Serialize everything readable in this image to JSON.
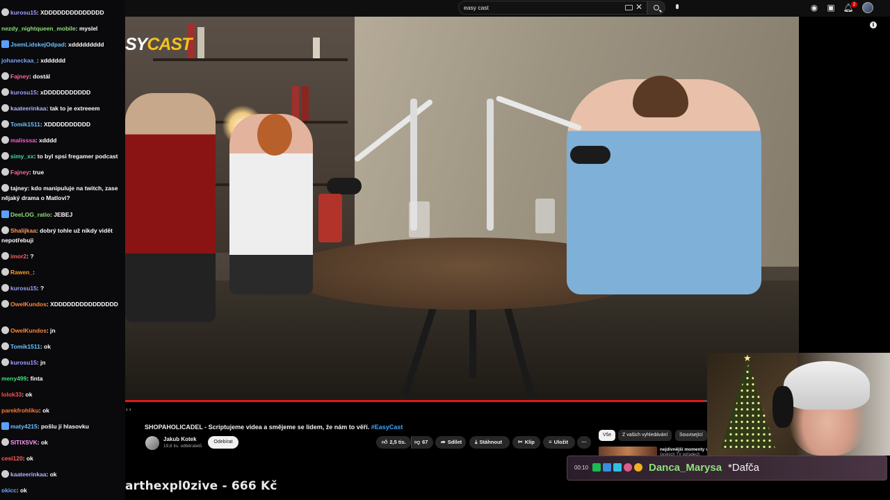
{
  "chat": {
    "messages": [
      {
        "user": "kurosu15",
        "text": "XDDDDDDDDDDDDDD",
        "user_color": "#a0a0ff",
        "badge": "hx"
      },
      {
        "user": "nezdy_nightqueen_mobile",
        "text": "myslel",
        "user_color": "#8ee07a",
        "badge": ""
      },
      {
        "user": "JsemLidskejOdpad",
        "text": "xddddddddd",
        "user_color": "#6ec1ff",
        "badge": "sq"
      },
      {
        "user": "johaneckaa_",
        "text": "xdddddd",
        "user_color": "#7aa7ff",
        "badge": ""
      },
      {
        "user": "Fajney",
        "text": "dostál",
        "user_color": "#ff6b9a",
        "badge": "hx"
      },
      {
        "user": "kurosu15",
        "text": "xDDDDDDDDDDD",
        "user_color": "#a0a0ff",
        "badge": "hx"
      },
      {
        "user": "kaateerinkaa",
        "text": "tak to je extreeem",
        "user_color": "#b5b5ff",
        "badge": "hx"
      },
      {
        "user": "Tomik1511",
        "text": "XDDDDDDDDDD",
        "user_color": "#6ec1ff",
        "badge": "hx"
      },
      {
        "user": "malisssa",
        "text": "xdddd",
        "user_color": "#ff5fd0",
        "badge": "hx"
      },
      {
        "user": "simy_xx",
        "text": "to byl spsi fregamer podcast",
        "user_color": "#3ee0a0",
        "badge": "hx"
      },
      {
        "user": "Fajney",
        "text": "true",
        "user_color": "#ff6b9a",
        "badge": "hx"
      },
      {
        "user": "tajney",
        "text": "kdo manipuluje na twitch, zase nějaký drama o Matlovi?",
        "user_color": "#ffffff",
        "badge": "hx"
      },
      {
        "user": "DeeLOG_ratio",
        "text": "JEBEJ",
        "user_color": "#8ee07a",
        "badge": "sq"
      },
      {
        "user": "Shalijkaa",
        "text": "dobrý tohle už nikdy vidět nepotřebuji",
        "user_color": "#ff9a5a",
        "badge": "hx"
      },
      {
        "user": "imor2",
        "text": "?",
        "user_color": "#ff5f5f",
        "badge": "hx"
      },
      {
        "user": "Rawen_",
        "text": "",
        "user_color": "#ff9a2a",
        "badge": "hx"
      },
      {
        "user": "kurosu15",
        "text": "?",
        "user_color": "#a0a0ff",
        "badge": "hx"
      },
      {
        "user": "OwelKundos",
        "text": "XDDDDDDDDDDDDDDD",
        "user_color": "#ff8a3a",
        "badge": "hx"
      },
      {
        "user": "OwelKundos",
        "text": "jn",
        "user_color": "#ff8a3a",
        "badge": "hx"
      },
      {
        "user": "Tomik1511",
        "text": "ok",
        "user_color": "#6ec1ff",
        "badge": "hx"
      },
      {
        "user": "kurosu15",
        "text": "jn",
        "user_color": "#a0a0ff",
        "badge": "hx"
      },
      {
        "user": "meny499",
        "text": "finta",
        "user_color": "#3ee07a",
        "badge": ""
      },
      {
        "user": "lolok33",
        "text": "ok",
        "user_color": "#ff4f4f",
        "badge": ""
      },
      {
        "user": "parekfrohliku",
        "text": "ok",
        "user_color": "#ff7a3a",
        "badge": ""
      },
      {
        "user": "maty4215",
        "text": "pošlu jí hlasovku",
        "user_color": "#6ec1ff",
        "badge": "sq"
      },
      {
        "user": "SITIXSVK",
        "text": "ok",
        "user_color": "#ff9aff",
        "badge": "hx"
      },
      {
        "user": "cesi120",
        "text": "ok",
        "user_color": "#ff5f5f",
        "badge": ""
      },
      {
        "user": "kaateerinkaa",
        "text": "ok",
        "user_color": "#b5b5ff",
        "badge": "hx"
      },
      {
        "user": "okicc",
        "text": "ok",
        "user_color": "#7aa7ff",
        "badge": ""
      }
    ]
  },
  "youtube": {
    "search_query": "easy cast",
    "notification_count": "2",
    "video_logo_left": "SY",
    "video_logo_right": "CAST",
    "video_title": "SHOPAHOLICADEL - Scriptujeme videa a smějeme se lidem, že nám to věří.",
    "video_hashtag": "#EasyCast",
    "channel_name": "Jakub Kotek",
    "channel_subs": "19,8 tis. odběratelů",
    "subscribe_label": "Odebírat",
    "likes": "2,5 tis.",
    "dislikes": "67",
    "share_label": "Sdílet",
    "download_label": "Stáhnout",
    "clip_label": "Klip",
    "save_label": "Uložit",
    "more_label": "···",
    "progress": 0.86,
    "chips": [
      "Vše",
      "Z vašich vyhledávání",
      "Související"
    ],
    "rec_title": "nejdivnější momenty v",
    "rec_sub": "českých TV pořadech"
  },
  "overlay": {
    "donation_text": "arthexpl0zive - 666 Kč",
    "alert_time": "00:10",
    "alert_user": "Danca_Marysa",
    "alert_message": "*Dafča"
  },
  "colors": {
    "accent_red": "#e21818",
    "link_blue": "#3ea6ff",
    "alert_user_green": "#8ee07a",
    "logo_yellow": "#f2c21d"
  }
}
